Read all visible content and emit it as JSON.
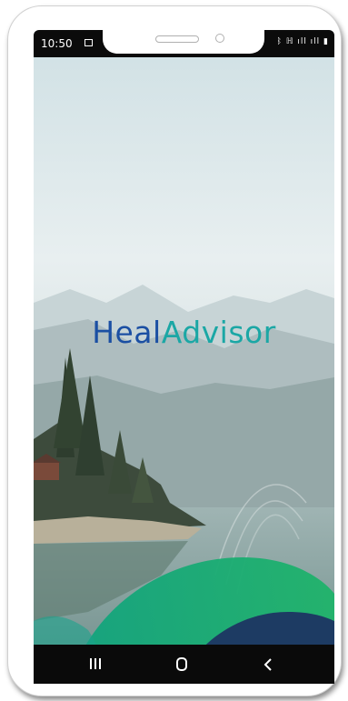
{
  "status_bar": {
    "time": "10:50",
    "right_icons": "ᛒ ℍ ıll ıll ▮",
    "icon_names": [
      "image-icon",
      "bluetooth-icon",
      "signal-icon",
      "battery-icon"
    ]
  },
  "splash": {
    "logo_part1": "Heal",
    "logo_part2": "Advisor",
    "colors": {
      "logo_blue": "#1b4fa3",
      "logo_teal": "#1ba7a5",
      "wave_green": "#16a36b",
      "wave_navy": "#1d3b63"
    }
  },
  "nav_bar": {
    "items": [
      "recent-apps-icon",
      "home-icon",
      "back-icon"
    ]
  }
}
